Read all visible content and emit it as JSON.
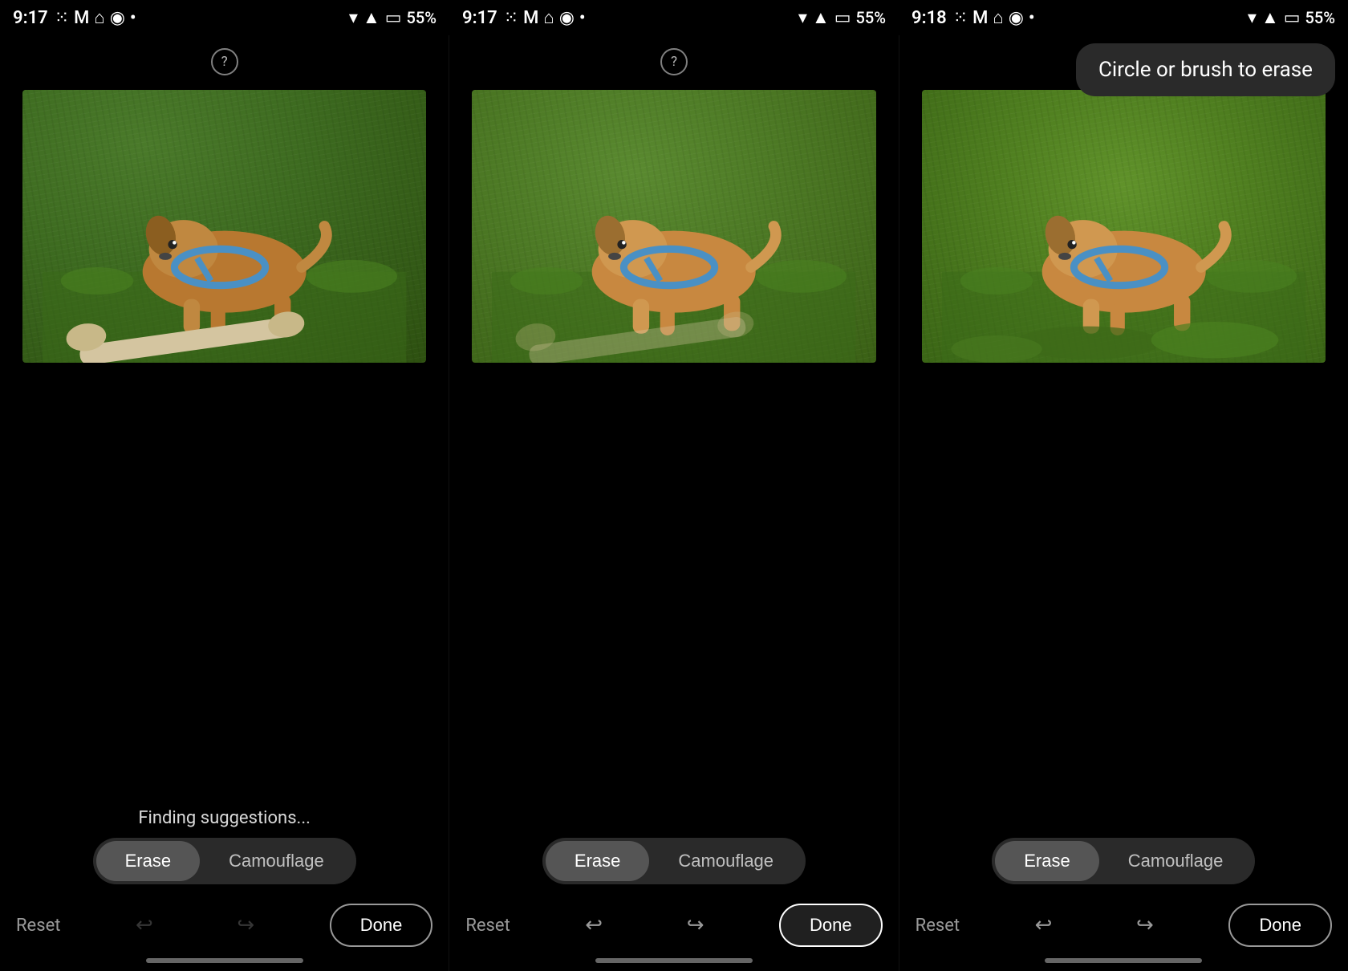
{
  "panels": [
    {
      "id": "panel-1",
      "statusBar": {
        "time": "9:17",
        "batteryPercent": "55%"
      },
      "helpIconLabel": "?",
      "showTooltip": false,
      "tooltipText": "",
      "imageAlt": "Dog on grass with bone",
      "showBone": true,
      "boneFading": false,
      "suggestionsText": "Finding suggestions...",
      "toggleButtons": [
        {
          "label": "Erase",
          "active": true
        },
        {
          "label": "Camouflage",
          "active": false
        }
      ],
      "resetLabel": "Reset",
      "doneLabel": "Done",
      "doneHighlighted": false
    },
    {
      "id": "panel-2",
      "statusBar": {
        "time": "9:17",
        "batteryPercent": "55%"
      },
      "helpIconLabel": "?",
      "showTooltip": false,
      "tooltipText": "",
      "imageAlt": "Dog on grass with fading bone",
      "showBone": true,
      "boneFading": true,
      "suggestionsText": "",
      "toggleButtons": [
        {
          "label": "Erase",
          "active": true
        },
        {
          "label": "Camouflage",
          "active": false
        }
      ],
      "resetLabel": "Reset",
      "doneLabel": "Done",
      "doneHighlighted": true
    },
    {
      "id": "panel-3",
      "statusBar": {
        "time": "9:18",
        "batteryPercent": "55%"
      },
      "helpIconLabel": "?",
      "showTooltip": true,
      "tooltipText": "Circle or brush to erase",
      "imageAlt": "Dog on grass without bone",
      "showBone": false,
      "boneFading": false,
      "suggestionsText": "",
      "toggleButtons": [
        {
          "label": "Erase",
          "active": true
        },
        {
          "label": "Camouflage",
          "active": false
        }
      ],
      "resetLabel": "Reset",
      "doneLabel": "Done",
      "doneHighlighted": false
    }
  ]
}
